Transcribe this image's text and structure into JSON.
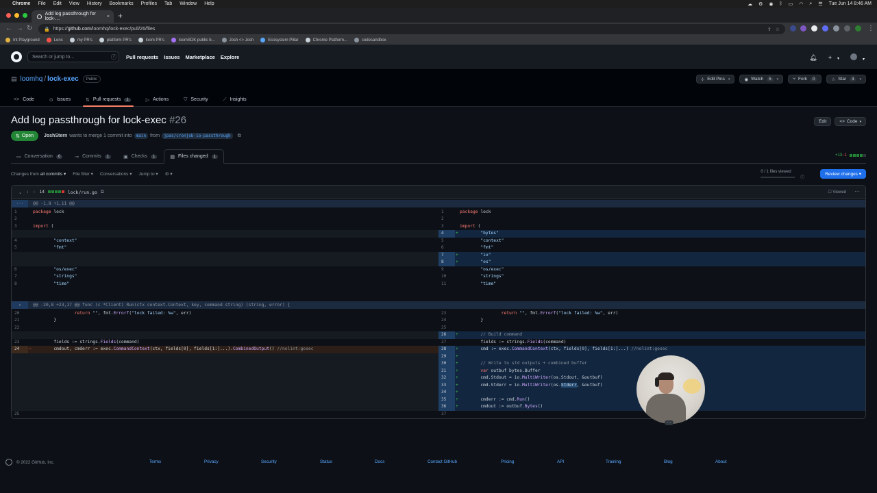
{
  "menubar": {
    "apple": "",
    "items": [
      "Chrome",
      "File",
      "Edit",
      "View",
      "History",
      "Bookmarks",
      "Profiles",
      "Tab",
      "Window",
      "Help"
    ],
    "clock": "Tue Jun 14  8:46 AM"
  },
  "browser": {
    "tab_title": "Add log passthrough for lock-…",
    "tab_close": "×",
    "new_tab": "+",
    "url_scheme": "https://",
    "url_host": "github.com",
    "url_path": "/loomhq/lock-exec/pull/26/files",
    "bookmarks": [
      {
        "label": "Int Playground",
        "color": "#e3b341"
      },
      {
        "label": "Lens",
        "color": "#f85149"
      },
      {
        "label": "my PR's",
        "color": "#c9d1d9"
      },
      {
        "label": "platform PR's",
        "color": "#c9d1d9"
      },
      {
        "label": "loom PR's",
        "color": "#c9d1d9"
      },
      {
        "label": "loomSDK public b...",
        "color": "#a371f7"
      },
      {
        "label": "Josh <> Josh",
        "color": "#8b949e"
      },
      {
        "label": "Ecosystem Pillar",
        "color": "#58a6ff"
      },
      {
        "label": "Chrome Platform...",
        "color": "#c9d1d9"
      },
      {
        "label": "codesandbox",
        "color": "#8b949e"
      }
    ]
  },
  "gh": {
    "search_placeholder": "Search or jump to...",
    "search_key": "/",
    "nav": [
      "Pull requests",
      "Issues",
      "Marketplace",
      "Explore"
    ],
    "plus": "+",
    "caret": "▾"
  },
  "repo": {
    "owner": "loomhq",
    "sep": "/",
    "name": "lock-exec",
    "visibility": "Public",
    "edit_pins": "Edit Pins",
    "watch": "Watch",
    "watch_count": "5",
    "fork": "Fork",
    "fork_count": "0",
    "star": "Star",
    "star_count": "3",
    "tabs": [
      {
        "label": "Code",
        "icon": "<>"
      },
      {
        "label": "Issues",
        "icon": "⊙"
      },
      {
        "label": "Pull requests",
        "icon": "⇅",
        "count": "1"
      },
      {
        "label": "Actions",
        "icon": "▷"
      },
      {
        "label": "Security",
        "icon": "⛉"
      },
      {
        "label": "Insights",
        "icon": "⟋"
      }
    ]
  },
  "pr": {
    "title": "Add log passthrough for lock-exec",
    "number": "#26",
    "edit": "Edit",
    "code": "Code",
    "state": "Open",
    "author": "JoshStern",
    "merge_text": "wants to merge 1 commit into",
    "base": "main",
    "from_text": "from",
    "head": "jpas/cronjob-io-passthrough",
    "tabs": [
      {
        "label": "Conversation",
        "count": "0",
        "icon": "▭"
      },
      {
        "label": "Commits",
        "count": "1",
        "icon": "⊸"
      },
      {
        "label": "Checks",
        "count": "1",
        "icon": "▣"
      },
      {
        "label": "Files changed",
        "count": "1",
        "icon": "▤"
      }
    ],
    "additions": "+13",
    "deletions": "−1"
  },
  "filebar": {
    "changes_from": "Changes from",
    "all_commits": "all commits ▾",
    "file_filter": "File filter ▾",
    "conversations": "Conversations ▾",
    "jump_to": "Jump to ▾",
    "settings": "⚙ ▾",
    "files_viewed": "0 / 1 files viewed",
    "review_changes": "Review changes ▾"
  },
  "file": {
    "changes": "14",
    "path": "lock/run.go",
    "viewed": "Viewed",
    "more": "···",
    "hunk1": "@@ -1,8 +1,11 @@",
    "hunk2": "@@ -20,8 +23,17 @@ func (c *Client) Run(ctx context.Context, key, command string) (string, error) {",
    "expand": "···"
  },
  "colors": {
    "add_bg": "#12263f",
    "add_gutter": "#1f3e63",
    "del_bg": "#2d1f17",
    "del_gutter": "#3e2a1c",
    "empty_bg": "#161b22",
    "accent": "#1f6feb",
    "open_green": "#238636"
  },
  "footer": {
    "copyright": "© 2022 GitHub, Inc.",
    "links": [
      "Terms",
      "Privacy",
      "Security",
      "Status",
      "Docs",
      "Contact GitHub",
      "Pricing",
      "API",
      "Training",
      "Blog",
      "About"
    ]
  },
  "webcam": {
    "menu": "···"
  }
}
